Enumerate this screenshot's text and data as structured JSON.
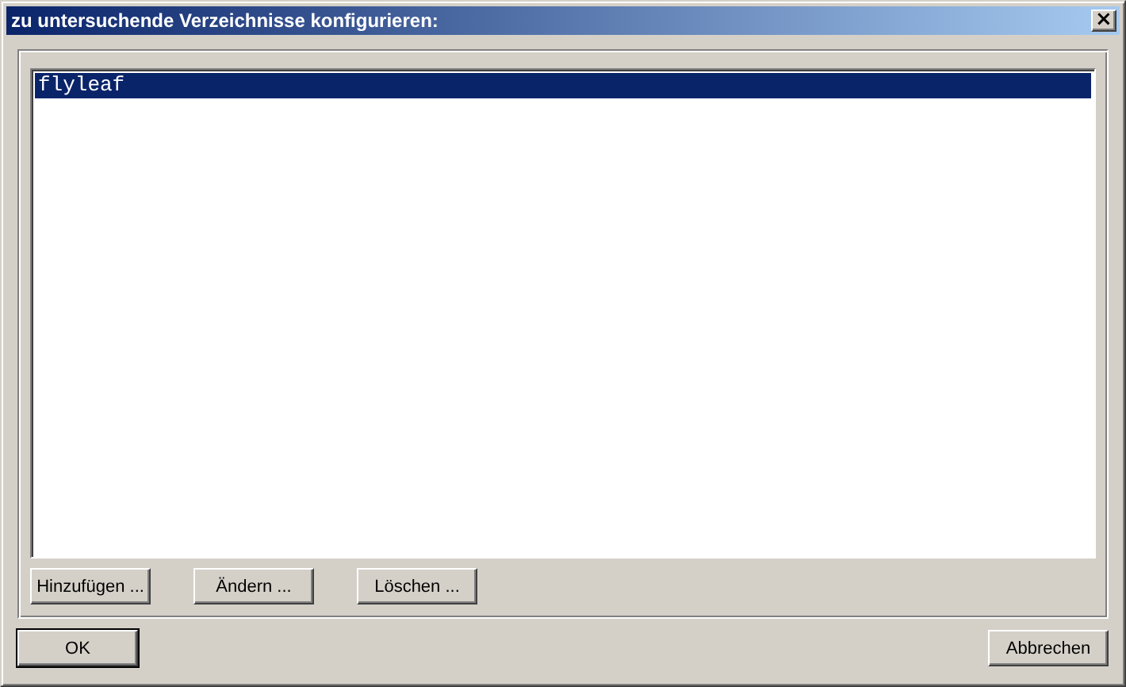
{
  "window": {
    "title": "zu untersuchende Verzeichnisse konfigurieren:",
    "close_button": "×"
  },
  "directories": [
    {
      "label": "flyleaf",
      "selected": true
    }
  ],
  "list_buttons": [
    "Hinzufügen ...",
    "Ändern ...",
    "Löschen ..."
  ],
  "dialog_buttons": [
    {
      "label": "OK",
      "default": true
    },
    {
      "label": "Abbrechen",
      "default": false
    }
  ]
}
